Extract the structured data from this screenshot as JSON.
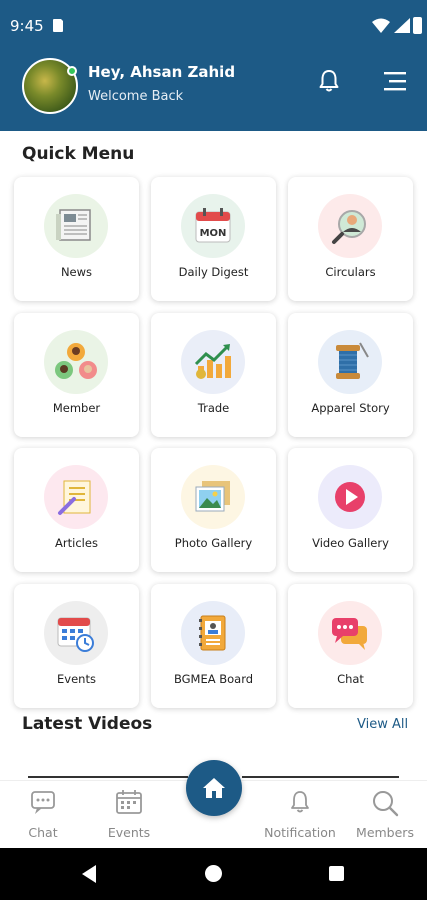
{
  "status_bar": {
    "time": "9:45"
  },
  "header": {
    "greeting": "Hey, Ahsan Zahid",
    "subtitle": "Welcome Back"
  },
  "quick_menu": {
    "title": "Quick Menu",
    "items": [
      {
        "label": "News",
        "icon": "newspaper-icon",
        "bg": "#eaf4e6"
      },
      {
        "label": "Daily Digest",
        "icon": "calendar-mon-icon",
        "bg": "#e8f3ec"
      },
      {
        "label": "Circulars",
        "icon": "person-search-icon",
        "bg": "#fdeaea"
      },
      {
        "label": "Member",
        "icon": "members-group-icon",
        "bg": "#eaf4e6"
      },
      {
        "label": "Trade",
        "icon": "trade-chart-icon",
        "bg": "#eaeef8"
      },
      {
        "label": "Apparel Story",
        "icon": "thread-spool-icon",
        "bg": "#e7eef8"
      },
      {
        "label": "Articles",
        "icon": "article-pen-icon",
        "bg": "#fde8ef"
      },
      {
        "label": "Photo Gallery",
        "icon": "photo-gallery-icon",
        "bg": "#fdf6e3"
      },
      {
        "label": "Video Gallery",
        "icon": "play-video-icon",
        "bg": "#ecebfb"
      },
      {
        "label": "Events",
        "icon": "event-calendar-icon",
        "bg": "#eeeeee"
      },
      {
        "label": "BGMEA Board",
        "icon": "board-book-icon",
        "bg": "#e8edf8"
      },
      {
        "label": "Chat",
        "icon": "chat-bubbles-icon",
        "bg": "#fdeaea"
      }
    ]
  },
  "latest_videos": {
    "title": "Latest Videos",
    "view_all": "View All"
  },
  "bottom_nav": {
    "chat": "Chat",
    "events": "Events",
    "notification": "Notification",
    "members": "Members"
  },
  "colors": {
    "primary": "#1d5a86",
    "online": "#36c45a"
  }
}
